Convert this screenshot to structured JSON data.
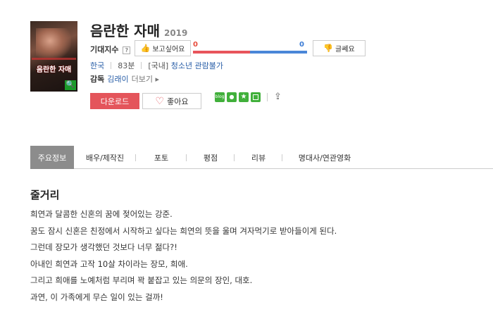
{
  "movie": {
    "title": "음란한 자매",
    "year": "2019",
    "poster_title": "음란한 자매"
  },
  "expectation": {
    "label": "기대지수",
    "help": "?",
    "want_label": "보고싶어요",
    "want_count": "0",
    "meh_count": "0",
    "meh_label": "글쎄요",
    "want_ratio": 0.5
  },
  "meta": {
    "country": "한국",
    "runtime": "83분",
    "rating_prefix": "[국내]",
    "rating": "청소년 관람불가"
  },
  "director": {
    "label": "감독",
    "name": "김래이",
    "more": "더보기 ▸"
  },
  "actions": {
    "download": "다운로드",
    "like": "좋아요",
    "share_blog": "blog"
  },
  "tabs": [
    {
      "label": "주요정보",
      "active": true
    },
    {
      "label": "배우/제작진",
      "active": false
    },
    {
      "label": "포토",
      "active": false
    },
    {
      "label": "평점",
      "active": false
    },
    {
      "label": "리뷰",
      "active": false
    },
    {
      "label": "명대사/연관영화",
      "active": false
    }
  ],
  "synopsis": {
    "heading": "줄거리",
    "lines": [
      "희연과 달콤한 신혼의 꿈에 젖어있는 강준.",
      " 꿈도 잠시 신혼은 친정에서 시작하고 싶다는 희연의 뜻을 울며 겨자먹기로 받아들이게 된다.",
      " 그런데 장모가 생각했던 것보다 너무 젊다?!",
      " 아내인 희연과 고작 10살 차이라는 장모, 희애.",
      " 그리고 희애를 노예처럼 부리며 꽉 붙잡고 있는 의문의 장인, 대호.",
      " 과연, 이 가족에게 무슨 일이 있는 걸까!"
    ]
  },
  "colors": {
    "want_red": "#e8555b",
    "meh_blue": "#4a86d8",
    "download_bg": "#e4555b",
    "active_tab_bg": "#8c8c8c",
    "link_blue": "#2a5fa8"
  }
}
